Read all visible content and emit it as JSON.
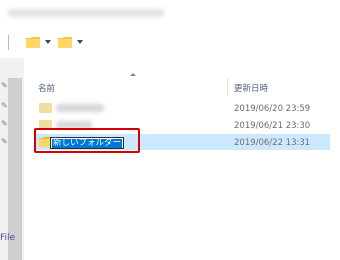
{
  "toolbar": {
    "folder_icon_1": "folder-icon",
    "folder_icon_2": "folder-icon",
    "dropdown_icon": "chevron-down-icon"
  },
  "navigation": {
    "pins": [
      "pin-icon",
      "pin-icon",
      "pin-icon",
      "pin-icon"
    ],
    "truncated_label": "File"
  },
  "columns": {
    "name": "名前",
    "modified": "更新日時"
  },
  "files": [
    {
      "name": "",
      "date": "2019/06/20 23:59",
      "icon": "folder-icon",
      "selected": false
    },
    {
      "name": "",
      "date": "2019/06/21 23:30",
      "icon": "folder-icon",
      "selected": false
    },
    {
      "name": "新しいフォルダー",
      "date": "2019/06/22 13:31",
      "icon": "folder-icon",
      "selected": true,
      "renaming": true
    }
  ],
  "colors": {
    "selection": "#cce8ff",
    "rename_highlight": "#0078d7",
    "annotation_box": "#d40000",
    "folder": "#f4c542"
  }
}
